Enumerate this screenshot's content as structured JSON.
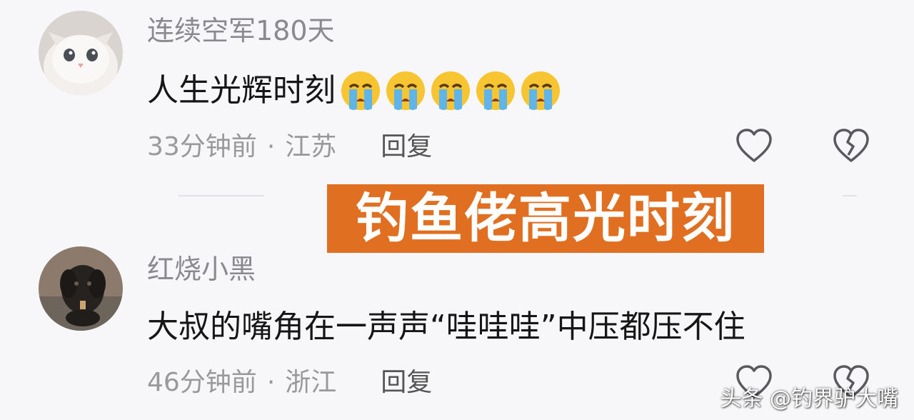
{
  "comments": [
    {
      "username": "连续空军180天",
      "text": "人生光辉时刻",
      "emoji": [
        "crying-face",
        "crying-face",
        "crying-face",
        "crying-face",
        "crying-face"
      ],
      "time": "33分钟前",
      "separator": "·",
      "location": "江苏",
      "reply_label": "回复",
      "avatar": "white-cat-avatar"
    },
    {
      "username": "红烧小黑",
      "text": "大叔的嘴角在一声声“哇哇哇”中压都压不住",
      "time": "46分钟前",
      "separator": "·",
      "location": "浙江",
      "reply_label": "回复",
      "avatar": "black-dog-avatar"
    }
  ],
  "banner": {
    "text": "钓鱼佬高光时刻",
    "background": "#e06f22",
    "color": "#ffffff"
  },
  "icons": {
    "like": "heart-outline-icon",
    "dislike": "broken-heart-icon"
  },
  "watermark": "头条 @钓界驴大嘴",
  "colors": {
    "background": "#f7f7f9",
    "username": "#8a8a8e",
    "meta": "#999999",
    "text": "#161616"
  }
}
